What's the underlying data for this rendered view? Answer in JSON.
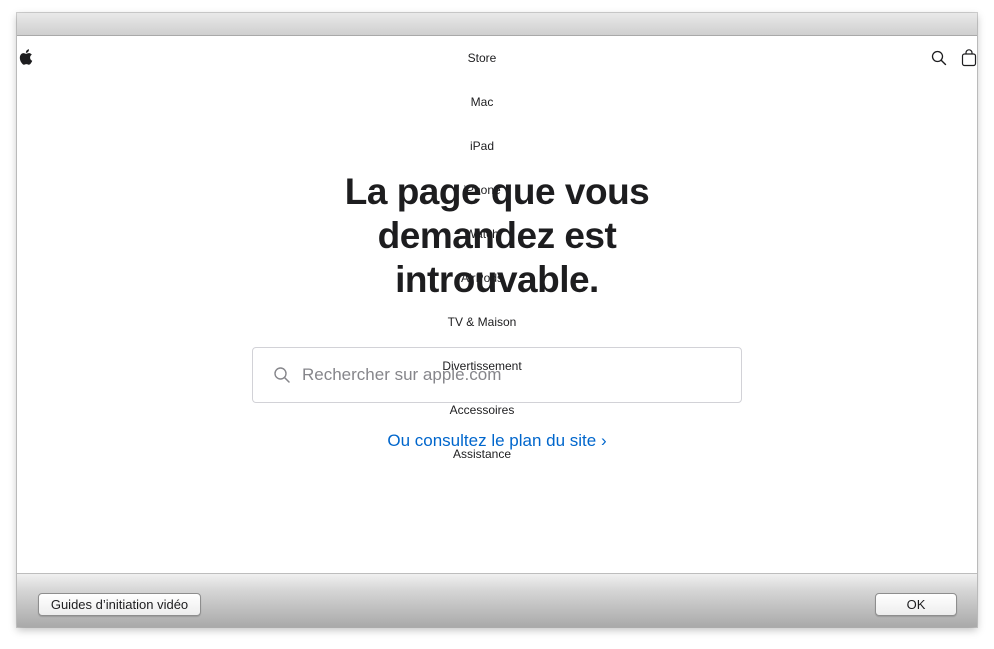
{
  "nav": {
    "items": [
      "Store",
      "Mac",
      "iPad",
      "iPhone",
      "Watch",
      "AirPods",
      "TV & Maison",
      "Divertissement",
      "Accessoires",
      "Assistance"
    ]
  },
  "icons": {
    "apple": "apple-logo-icon",
    "search": "search-icon",
    "bag": "shopping-bag-icon"
  },
  "main": {
    "headline": [
      "La page que vous",
      "demandez est",
      "introuvable."
    ],
    "search_placeholder": "Rechercher sur apple.com",
    "sitemap_link": "Ou consultez le plan du site ›"
  },
  "footer": {
    "guides_button": "Guides d’initiation vidéo",
    "ok_button": "OK"
  },
  "colors": {
    "link": "#0066cc",
    "text": "#1d1d1f",
    "placeholder": "#86868b"
  }
}
